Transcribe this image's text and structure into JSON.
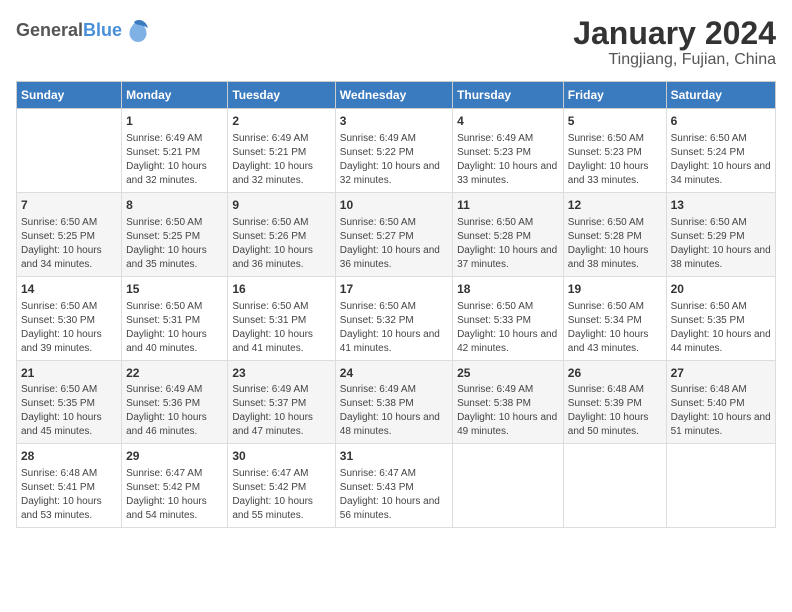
{
  "header": {
    "logo_general": "General",
    "logo_blue": "Blue",
    "title": "January 2024",
    "subtitle": "Tingjiang, Fujian, China"
  },
  "calendar": {
    "days_of_week": [
      "Sunday",
      "Monday",
      "Tuesday",
      "Wednesday",
      "Thursday",
      "Friday",
      "Saturday"
    ],
    "weeks": [
      [
        {
          "day": "",
          "sunrise": "",
          "sunset": "",
          "daylight": "",
          "empty": true
        },
        {
          "day": "1",
          "sunrise": "Sunrise: 6:49 AM",
          "sunset": "Sunset: 5:21 PM",
          "daylight": "Daylight: 10 hours and 32 minutes."
        },
        {
          "day": "2",
          "sunrise": "Sunrise: 6:49 AM",
          "sunset": "Sunset: 5:21 PM",
          "daylight": "Daylight: 10 hours and 32 minutes."
        },
        {
          "day": "3",
          "sunrise": "Sunrise: 6:49 AM",
          "sunset": "Sunset: 5:22 PM",
          "daylight": "Daylight: 10 hours and 32 minutes."
        },
        {
          "day": "4",
          "sunrise": "Sunrise: 6:49 AM",
          "sunset": "Sunset: 5:23 PM",
          "daylight": "Daylight: 10 hours and 33 minutes."
        },
        {
          "day": "5",
          "sunrise": "Sunrise: 6:50 AM",
          "sunset": "Sunset: 5:23 PM",
          "daylight": "Daylight: 10 hours and 33 minutes."
        },
        {
          "day": "6",
          "sunrise": "Sunrise: 6:50 AM",
          "sunset": "Sunset: 5:24 PM",
          "daylight": "Daylight: 10 hours and 34 minutes."
        }
      ],
      [
        {
          "day": "7",
          "sunrise": "Sunrise: 6:50 AM",
          "sunset": "Sunset: 5:25 PM",
          "daylight": "Daylight: 10 hours and 34 minutes."
        },
        {
          "day": "8",
          "sunrise": "Sunrise: 6:50 AM",
          "sunset": "Sunset: 5:25 PM",
          "daylight": "Daylight: 10 hours and 35 minutes."
        },
        {
          "day": "9",
          "sunrise": "Sunrise: 6:50 AM",
          "sunset": "Sunset: 5:26 PM",
          "daylight": "Daylight: 10 hours and 36 minutes."
        },
        {
          "day": "10",
          "sunrise": "Sunrise: 6:50 AM",
          "sunset": "Sunset: 5:27 PM",
          "daylight": "Daylight: 10 hours and 36 minutes."
        },
        {
          "day": "11",
          "sunrise": "Sunrise: 6:50 AM",
          "sunset": "Sunset: 5:28 PM",
          "daylight": "Daylight: 10 hours and 37 minutes."
        },
        {
          "day": "12",
          "sunrise": "Sunrise: 6:50 AM",
          "sunset": "Sunset: 5:28 PM",
          "daylight": "Daylight: 10 hours and 38 minutes."
        },
        {
          "day": "13",
          "sunrise": "Sunrise: 6:50 AM",
          "sunset": "Sunset: 5:29 PM",
          "daylight": "Daylight: 10 hours and 38 minutes."
        }
      ],
      [
        {
          "day": "14",
          "sunrise": "Sunrise: 6:50 AM",
          "sunset": "Sunset: 5:30 PM",
          "daylight": "Daylight: 10 hours and 39 minutes."
        },
        {
          "day": "15",
          "sunrise": "Sunrise: 6:50 AM",
          "sunset": "Sunset: 5:31 PM",
          "daylight": "Daylight: 10 hours and 40 minutes."
        },
        {
          "day": "16",
          "sunrise": "Sunrise: 6:50 AM",
          "sunset": "Sunset: 5:31 PM",
          "daylight": "Daylight: 10 hours and 41 minutes."
        },
        {
          "day": "17",
          "sunrise": "Sunrise: 6:50 AM",
          "sunset": "Sunset: 5:32 PM",
          "daylight": "Daylight: 10 hours and 41 minutes."
        },
        {
          "day": "18",
          "sunrise": "Sunrise: 6:50 AM",
          "sunset": "Sunset: 5:33 PM",
          "daylight": "Daylight: 10 hours and 42 minutes."
        },
        {
          "day": "19",
          "sunrise": "Sunrise: 6:50 AM",
          "sunset": "Sunset: 5:34 PM",
          "daylight": "Daylight: 10 hours and 43 minutes."
        },
        {
          "day": "20",
          "sunrise": "Sunrise: 6:50 AM",
          "sunset": "Sunset: 5:35 PM",
          "daylight": "Daylight: 10 hours and 44 minutes."
        }
      ],
      [
        {
          "day": "21",
          "sunrise": "Sunrise: 6:50 AM",
          "sunset": "Sunset: 5:35 PM",
          "daylight": "Daylight: 10 hours and 45 minutes."
        },
        {
          "day": "22",
          "sunrise": "Sunrise: 6:49 AM",
          "sunset": "Sunset: 5:36 PM",
          "daylight": "Daylight: 10 hours and 46 minutes."
        },
        {
          "day": "23",
          "sunrise": "Sunrise: 6:49 AM",
          "sunset": "Sunset: 5:37 PM",
          "daylight": "Daylight: 10 hours and 47 minutes."
        },
        {
          "day": "24",
          "sunrise": "Sunrise: 6:49 AM",
          "sunset": "Sunset: 5:38 PM",
          "daylight": "Daylight: 10 hours and 48 minutes."
        },
        {
          "day": "25",
          "sunrise": "Sunrise: 6:49 AM",
          "sunset": "Sunset: 5:38 PM",
          "daylight": "Daylight: 10 hours and 49 minutes."
        },
        {
          "day": "26",
          "sunrise": "Sunrise: 6:48 AM",
          "sunset": "Sunset: 5:39 PM",
          "daylight": "Daylight: 10 hours and 50 minutes."
        },
        {
          "day": "27",
          "sunrise": "Sunrise: 6:48 AM",
          "sunset": "Sunset: 5:40 PM",
          "daylight": "Daylight: 10 hours and 51 minutes."
        }
      ],
      [
        {
          "day": "28",
          "sunrise": "Sunrise: 6:48 AM",
          "sunset": "Sunset: 5:41 PM",
          "daylight": "Daylight: 10 hours and 53 minutes."
        },
        {
          "day": "29",
          "sunrise": "Sunrise: 6:47 AM",
          "sunset": "Sunset: 5:42 PM",
          "daylight": "Daylight: 10 hours and 54 minutes."
        },
        {
          "day": "30",
          "sunrise": "Sunrise: 6:47 AM",
          "sunset": "Sunset: 5:42 PM",
          "daylight": "Daylight: 10 hours and 55 minutes."
        },
        {
          "day": "31",
          "sunrise": "Sunrise: 6:47 AM",
          "sunset": "Sunset: 5:43 PM",
          "daylight": "Daylight: 10 hours and 56 minutes."
        },
        {
          "day": "",
          "sunrise": "",
          "sunset": "",
          "daylight": "",
          "empty": true
        },
        {
          "day": "",
          "sunrise": "",
          "sunset": "",
          "daylight": "",
          "empty": true
        },
        {
          "day": "",
          "sunrise": "",
          "sunset": "",
          "daylight": "",
          "empty": true
        }
      ]
    ]
  }
}
